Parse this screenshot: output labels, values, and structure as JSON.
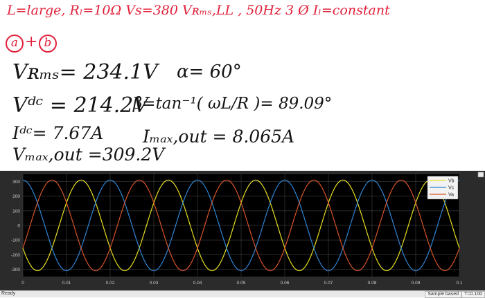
{
  "notes": {
    "line1": "L=large,  Rₗ=10Ω   Vs=380 Vʀₘₛ,LL , 50Hz   3 Ø  Iₗ=constant",
    "line2_a": "a",
    "line2_plus": "+",
    "line2_b": "b",
    "vrms": "Vʀₘₛ= 234.1V",
    "alpha": "α= 60°",
    "vdc": "Vᵈᶜ = 214.2V",
    "beta": "β=tan⁻¹( ωL/R )= 89.09°",
    "idc": "Iᵈᶜ= 7.67A",
    "imax": "Iₘₐₓ,out = 8.065A",
    "vmax": "Vₘₐₓ,out =309.2V"
  },
  "status": {
    "ready": "Ready",
    "sample_based": "Sample based",
    "time": "T=0.100"
  },
  "chart_data": {
    "type": "line",
    "xlim": [
      0,
      0.1
    ],
    "ylim": [
      -350,
      350
    ],
    "xticks": [
      "0",
      "0.01",
      "0.02",
      "0.03",
      "0.04",
      "0.05",
      "0.06",
      "0.07",
      "0.08",
      "0.09",
      "0.1"
    ],
    "yticks": [
      "300",
      "200",
      "100",
      "0",
      "-100",
      "-200",
      "-300"
    ],
    "grid": true,
    "legend_position": "top-right",
    "amplitude": 310,
    "frequency_hz": 50,
    "series": [
      {
        "name": "Vb",
        "color": "#e8e020",
        "phase_deg": -150
      },
      {
        "name": "Vc",
        "color": "#2f86d6",
        "phase_deg": 90
      },
      {
        "name": "Va",
        "color": "#d9542a",
        "phase_deg": -30
      }
    ]
  }
}
